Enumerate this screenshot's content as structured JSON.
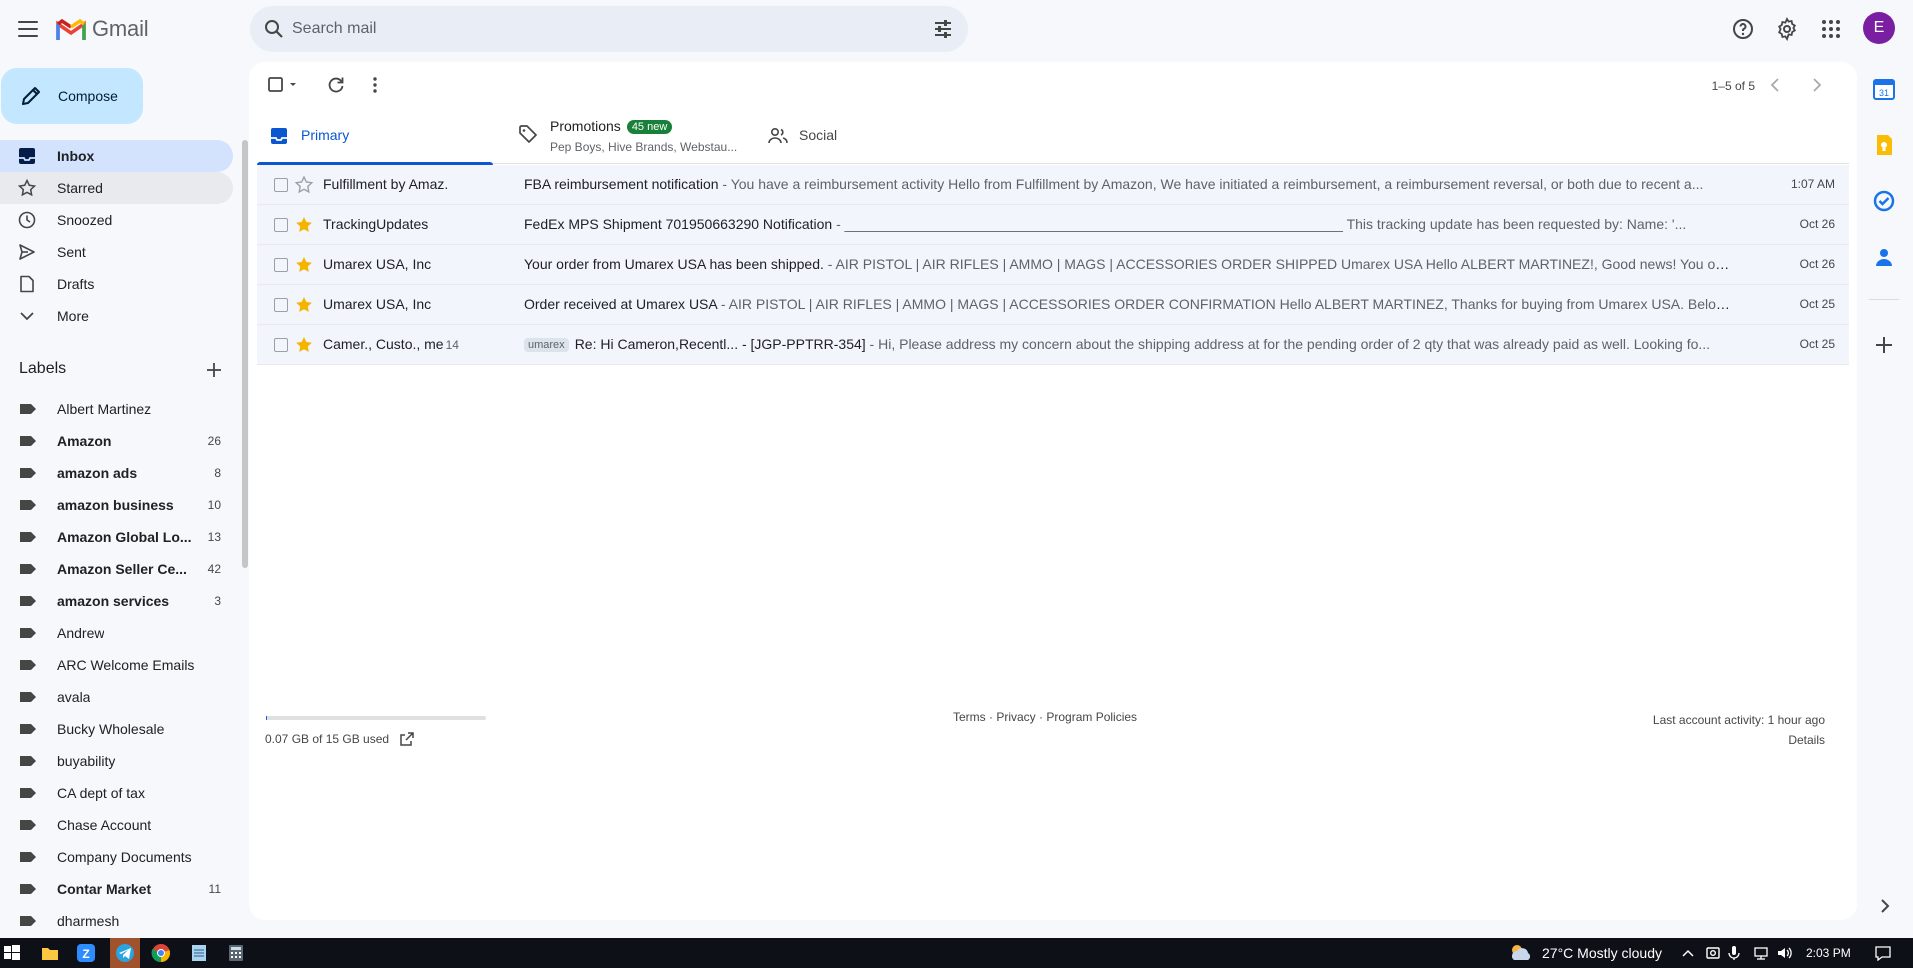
{
  "app": {
    "logo_text": "Gmail",
    "avatar_letter": "E"
  },
  "search": {
    "placeholder": "Search mail"
  },
  "compose": {
    "label": "Compose"
  },
  "nav": [
    {
      "label": "Inbox",
      "icon": "inbox-icon"
    },
    {
      "label": "Starred",
      "icon": "star-icon"
    },
    {
      "label": "Snoozed",
      "icon": "clock-icon"
    },
    {
      "label": "Sent",
      "icon": "send-icon"
    },
    {
      "label": "Drafts",
      "icon": "draft-icon"
    },
    {
      "label": "More",
      "icon": "chevron-down-icon"
    }
  ],
  "labels": {
    "header": "Labels",
    "items": [
      {
        "name": "Albert Martinez",
        "count": ""
      },
      {
        "name": "Amazon",
        "count": "26"
      },
      {
        "name": "amazon ads",
        "count": "8"
      },
      {
        "name": "amazon business",
        "count": "10"
      },
      {
        "name": "Amazon Global Lo...",
        "count": "13"
      },
      {
        "name": "Amazon Seller Ce...",
        "count": "42"
      },
      {
        "name": "amazon services",
        "count": "3"
      },
      {
        "name": "Andrew",
        "count": ""
      },
      {
        "name": "ARC Welcome Emails",
        "count": ""
      },
      {
        "name": "avala",
        "count": ""
      },
      {
        "name": "Bucky Wholesale",
        "count": ""
      },
      {
        "name": "buyability",
        "count": ""
      },
      {
        "name": "CA dept of tax",
        "count": ""
      },
      {
        "name": "Chase Account",
        "count": ""
      },
      {
        "name": "Company Documents",
        "count": ""
      },
      {
        "name": "Contar Market",
        "count": "11"
      },
      {
        "name": "dharmesh",
        "count": ""
      }
    ]
  },
  "toolbar": {
    "pagination": "1–5 of 5"
  },
  "tabs": {
    "primary": "Primary",
    "promotions": "Promotions",
    "promotions_badge": "45 new",
    "promotions_sub": "Pep Boys, Hive Brands, Webstau...",
    "social": "Social"
  },
  "emails": [
    {
      "sender": "Fulfillment by Amaz.",
      "count": "",
      "chip": "",
      "subject": "FBA reimbursement notification",
      "snippet": " - You have a reimbursement activity Hello from Fulfillment by Amazon, We have initiated a reimbursement, a reimbursement reversal, or both due to recent a...",
      "date": "1:07 AM",
      "starred": false
    },
    {
      "sender": "TrackingUpdates",
      "count": "",
      "chip": "",
      "subject": "FedEx MPS Shipment 701950663290 Notification",
      "snippet": " - ________________________________________________________________ This tracking update has been requested by: Name: '...",
      "date": "Oct 26",
      "starred": true
    },
    {
      "sender": "Umarex USA, Inc",
      "count": "",
      "chip": "",
      "subject": "Your order from Umarex USA has been shipped.",
      "snippet": " - AIR PISTOL | AIR RIFLES | AMMO | MAGS | ACCESSORIES ORDER SHIPPED Umarex USA Hello ALBERT MARTINEZ!, Good news! You order ha...",
      "date": "Oct 26",
      "starred": true
    },
    {
      "sender": "Umarex USA, Inc",
      "count": "",
      "chip": "",
      "subject": "Order received at Umarex USA",
      "snippet": " - AIR PISTOL | AIR RIFLES | AMMO | MAGS | ACCESSORIES ORDER CONFIRMATION Hello ALBERT MARTINEZ, Thanks for buying from Umarex USA. Below is th...",
      "date": "Oct 25",
      "starred": true
    },
    {
      "sender": "Camer., Custo., me",
      "count": "14",
      "chip": "umarex",
      "subject": "Re: Hi Cameron,Recentl... - [JGP-PPTRR-354]",
      "snippet": " - Hi, Please address my concern about the shipping address at for the pending order of 2 qty that was already paid as well. Looking fo...",
      "date": "Oct 25",
      "starred": true
    }
  ],
  "footer": {
    "storage": "0.07 GB of 15 GB used",
    "storage_fraction": 0.005,
    "terms": "Terms",
    "privacy": "Privacy",
    "policies": "Program Policies",
    "sep": " · ",
    "activity": "Last account activity: 1 hour ago",
    "details": "Details"
  },
  "taskbar": {
    "weather": "27°C  Mostly cloudy",
    "time": "2:03 PM"
  },
  "colors": {
    "accent": "#0b57d0",
    "compose_bg": "#c2e7ff",
    "star": "#f4b400",
    "badge": "#188038",
    "avatar": "#7b1fa2"
  }
}
